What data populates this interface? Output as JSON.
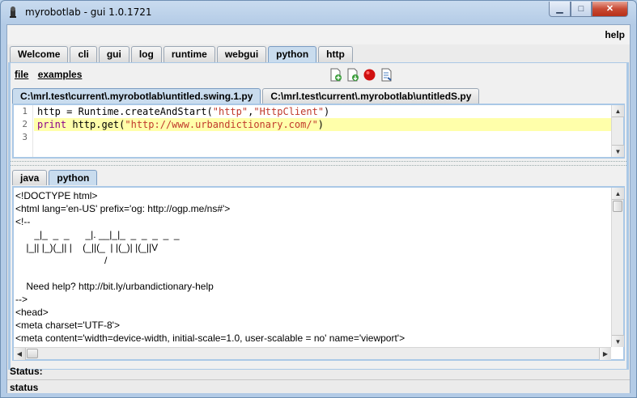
{
  "window": {
    "title": "myrobotlab - gui 1.0.1721",
    "controls": {
      "minimize": "▁",
      "maximize": "□",
      "close": "✕"
    }
  },
  "menu": {
    "help": "help"
  },
  "tabs": [
    "Welcome",
    "cli",
    "gui",
    "log",
    "runtime",
    "webgui",
    "python",
    "http"
  ],
  "active_tab": "python",
  "python_menu": {
    "file": "file",
    "examples": "examples"
  },
  "toolbar": [
    "new-script-icon",
    "open-script-icon",
    "stop-icon",
    "execute-icon"
  ],
  "file_tabs": [
    "C:\\mrl.test\\current\\.myrobotlab\\untitled.swing.1.py",
    "C:\\mrl.test\\current\\.myrobotlab\\untitledS.py"
  ],
  "editor": {
    "line_numbers": [
      "1",
      "2",
      "3"
    ],
    "line1": {
      "a": "http = Runtime.createAndStart(",
      "b": "\"http\"",
      "c": ",",
      "d": "\"HttpClient\"",
      "e": ")"
    },
    "line2": {
      "kw": "print",
      "a": " http.get(",
      "b": "\"http://www.urbandictionary.com/\"",
      "c": ")"
    }
  },
  "lower_tabs": [
    "java",
    "python"
  ],
  "console_lines": [
    "<!DOCTYPE html>",
    "<html lang='en-US' prefix='og: http://ogp.me/ns#'>",
    "<!--",
    "       _|_  _  _      _|. __|_|_  _  _  _  _  _",
    "    |_|| |_)(_|| |    (_||(_  | |(_)| |(_||V",
    "                                 /",
    "",
    "    Need help? http://bit.ly/urbandictionary-help",
    "-->",
    "<head>",
    "<meta charset='UTF-8'>",
    "<meta content='width=device-width, initial-scale=1.0, user-scalable = no' name='viewport'>"
  ],
  "status": {
    "label1": "Status:",
    "label2": "status"
  }
}
